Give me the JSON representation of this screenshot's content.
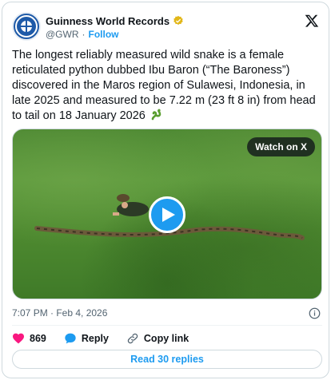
{
  "account": {
    "display_name": "Guinness World Records",
    "handle": "@GWR",
    "separator": "·",
    "follow_label": "Follow"
  },
  "tweet": {
    "text": "The longest reliably measured wild snake is a female reticulated python dubbed Ibu Baron (“The Baroness”) discovered in the Maros region of Sulawesi, Indonesia, in late 2025 and measured to be 7.22 m (23 ft 8 in) from head to tail on 18 January 2026",
    "emoji": "snake-emoji"
  },
  "media": {
    "watch_label": "Watch on X"
  },
  "timestamp": "7:07 PM · Feb 4, 2026",
  "actions": {
    "likes": "869",
    "reply_label": "Reply",
    "copy_label": "Copy link"
  },
  "read_replies_label": "Read 30 replies",
  "colors": {
    "accent": "#1d9bf0",
    "like": "#f91880",
    "verified": "#e2b719",
    "text": "#0f1419",
    "muted": "#536471"
  }
}
